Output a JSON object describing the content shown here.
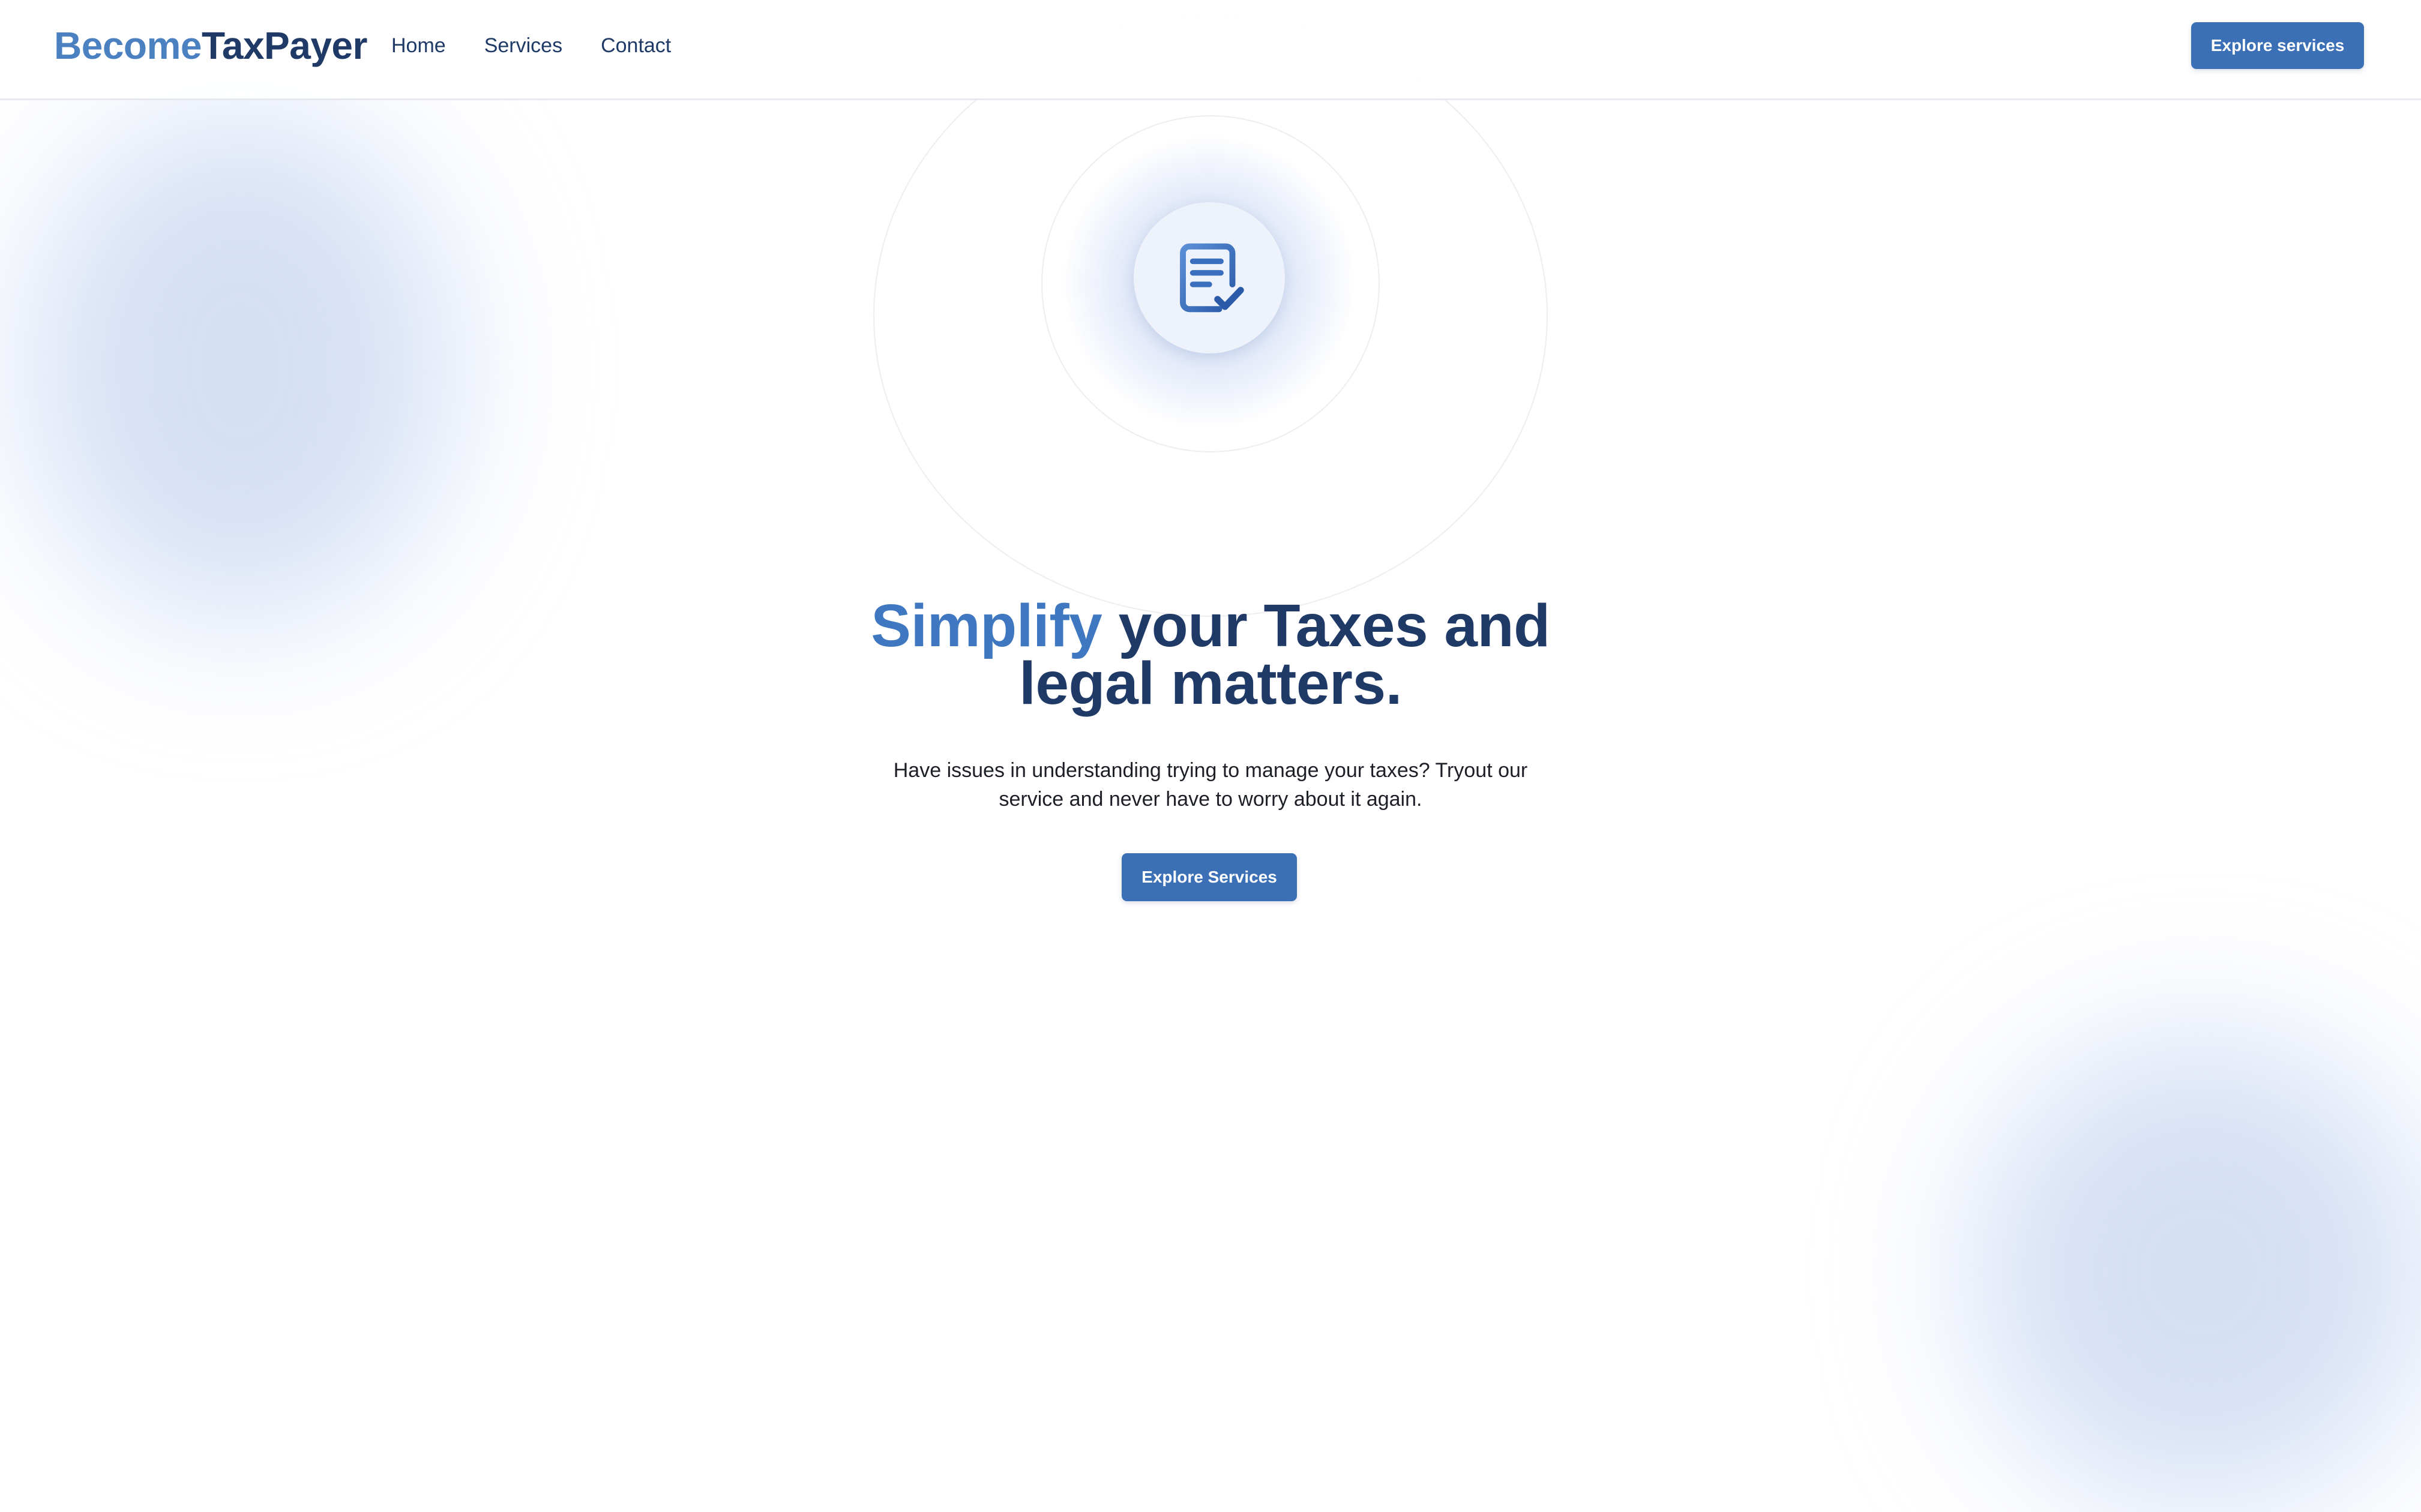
{
  "navbar": {
    "logo": {
      "part1": "Become",
      "part2": "TaxPayer"
    },
    "links": [
      {
        "label": "Home"
      },
      {
        "label": "Services"
      },
      {
        "label": "Contact"
      }
    ],
    "cta_label": "Explore services"
  },
  "hero": {
    "icon": "document-check-icon",
    "title_highlight": "Simplify",
    "title_line1_rest": " your Taxes and",
    "title_line2": "legal matters.",
    "subtitle_line1": "Have issues in understanding trying to manage your taxes? Tryout our",
    "subtitle_line2": "service and never have to worry about it again.",
    "cta_label": "Explore Services"
  },
  "colors": {
    "brand_primary": "#3b6fb6",
    "brand_light": "#4b80c1",
    "brand_dark": "#1f3a66",
    "background": "#ffffff"
  }
}
